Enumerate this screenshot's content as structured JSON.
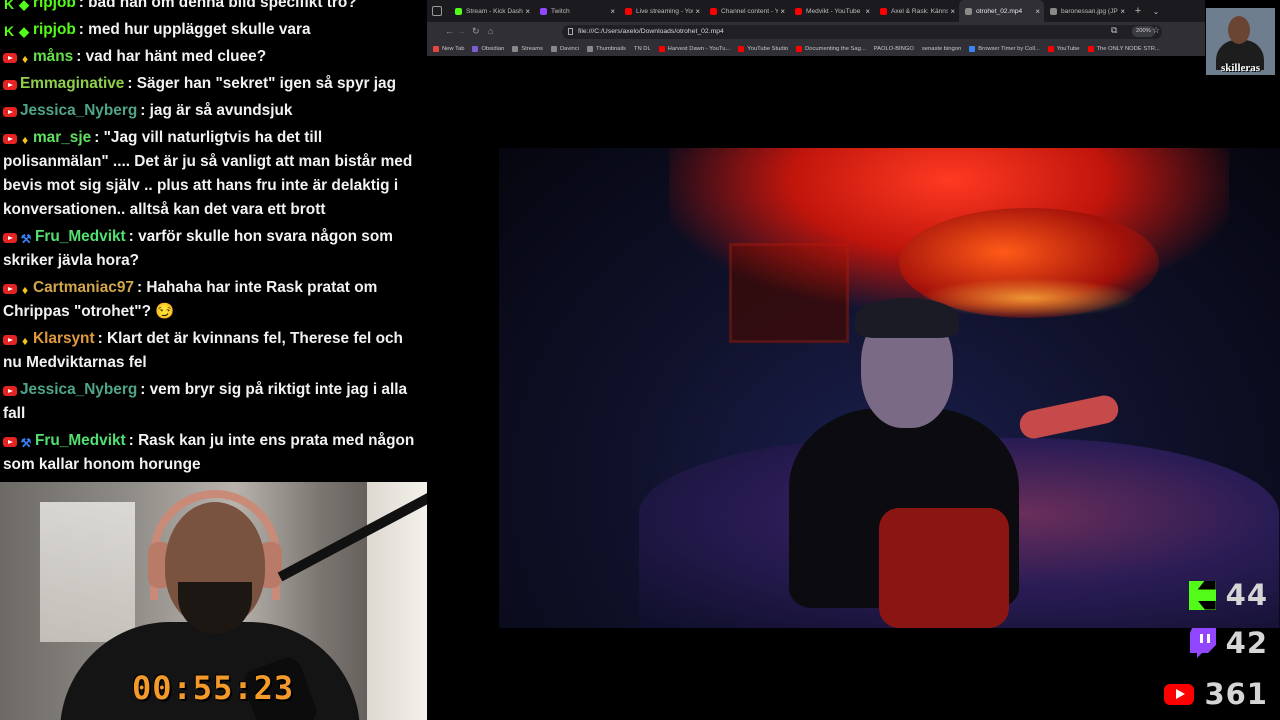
{
  "chat": {
    "messages": [
      {
        "badges": [
          "kick",
          "diamond"
        ],
        "user": "ripjob",
        "user_color": "#53fc18",
        "text": "bad han om denna bild specifikt tro?"
      },
      {
        "badges": [
          "kick",
          "diamond"
        ],
        "user": "ripjob",
        "user_color": "#53fc18",
        "text": "med hur upplägget skulle vara"
      },
      {
        "badges": [
          "youtube",
          "bulb"
        ],
        "user": "måns",
        "user_color": "#66e04a",
        "text": "vad har hänt med cluee?"
      },
      {
        "badges": [
          "youtube"
        ],
        "user": "Emmaginative",
        "user_color": "#8fcf4a",
        "text": "Säger han \"sekret\" igen så spyr jag"
      },
      {
        "badges": [
          "youtube"
        ],
        "user": "Jessica_Nyberg",
        "user_color": "#4fa58a",
        "text": "jag är så avundsjuk"
      },
      {
        "badges": [
          "youtube",
          "bulb"
        ],
        "user": "mar_sje",
        "user_color": "#5fe05f",
        "text": "\"Jag vill naturligtvis ha det till polisanmälan\" .... Det är ju så vanligt att man bistår med bevis mot sig själv .. plus att hans fru inte är delaktig i konversationen.. alltså kan det vara ett brott"
      },
      {
        "badges": [
          "youtube",
          "wrench"
        ],
        "user": "Fru_Medvikt",
        "user_color": "#52e070",
        "text": "varför skulle hon svara någon som skriker jävla hora?"
      },
      {
        "badges": [
          "youtube",
          "bulb"
        ],
        "user": "Cartmaniac97",
        "user_color": "#d2a64a",
        "text": "Hahaha har inte Rask pratat om Chrippas \"otrohet\"? 😏"
      },
      {
        "badges": [
          "youtube",
          "bulb"
        ],
        "user": "Klarsynt",
        "user_color": "#e09a3c",
        "text": "Klart det är kvinnans fel, Therese fel och nu Medviktarnas fel"
      },
      {
        "badges": [
          "youtube"
        ],
        "user": "Jessica_Nyberg",
        "user_color": "#4fa58a",
        "text": "vem bryr sig på riktigt inte jag i alla fall"
      },
      {
        "badges": [
          "youtube",
          "wrench"
        ],
        "user": "Fru_Medvikt",
        "user_color": "#52e070",
        "text": "Rask kan ju inte ens prata med någon som kallar honom horunge"
      }
    ]
  },
  "webcam": {
    "timer": "00:55:23"
  },
  "browser": {
    "tabs": [
      {
        "label": "Stream - Kick Dashbo",
        "fav_color": "#53fc18",
        "active": false
      },
      {
        "label": "Twitch",
        "fav_color": "#9146ff",
        "active": false
      },
      {
        "label": "Live streaming - You",
        "fav_color": "#ff0000",
        "active": false
      },
      {
        "label": "Channel content - Yo",
        "fav_color": "#ff0000",
        "active": false
      },
      {
        "label": "Medvikt - YouTube",
        "fav_color": "#ff0000",
        "active": false
      },
      {
        "label": "Axel & Rask: Känns o",
        "fav_color": "#ff0000",
        "active": false
      },
      {
        "label": "otrohet_02.mp4",
        "fav_color": "#8a8a8a",
        "active": true
      },
      {
        "label": "baronessan.jpg (JPEG ima",
        "fav_color": "#8a8a8a",
        "active": false
      }
    ],
    "newtab_label": "+",
    "url": "file:///C:/Users/axelo/Downloads/otrohet_02.mp4",
    "zoom": "200%",
    "bookmarks": [
      {
        "label": "New Tab",
        "fav_color": "#e8453c"
      },
      {
        "label": "Obsidian",
        "fav_color": "#7c5cd6"
      },
      {
        "label": "Streams",
        "fav_color": "#888888"
      },
      {
        "label": "Davinci",
        "fav_color": "#888888"
      },
      {
        "label": "Thumbnails",
        "fav_color": "#888888"
      },
      {
        "label": "TN DL",
        "fav_color": ""
      },
      {
        "label": "Harvest Dawn - YouTu...",
        "fav_color": "#ff0000"
      },
      {
        "label": "YouTube Studio",
        "fav_color": "#ff0000"
      },
      {
        "label": "Documenting the Sag...",
        "fav_color": "#ff0000"
      },
      {
        "label": "PAOLO-BINGO",
        "fav_color": ""
      },
      {
        "label": "senaste bingon",
        "fav_color": ""
      },
      {
        "label": "Browser Timer by Coll...",
        "fav_color": "#3b82f6"
      },
      {
        "label": "YouTube",
        "fav_color": "#ff0000"
      },
      {
        "label": "The ONLY NODE STR...",
        "fav_color": "#ff0000"
      }
    ]
  },
  "channel": {
    "name": "skilleras"
  },
  "viewers": {
    "kick": "44",
    "twitch": "42",
    "youtube": "361",
    "kick_color": "#53fc18",
    "twitch_color": "#9146ff",
    "youtube_color": "#ff0000"
  }
}
